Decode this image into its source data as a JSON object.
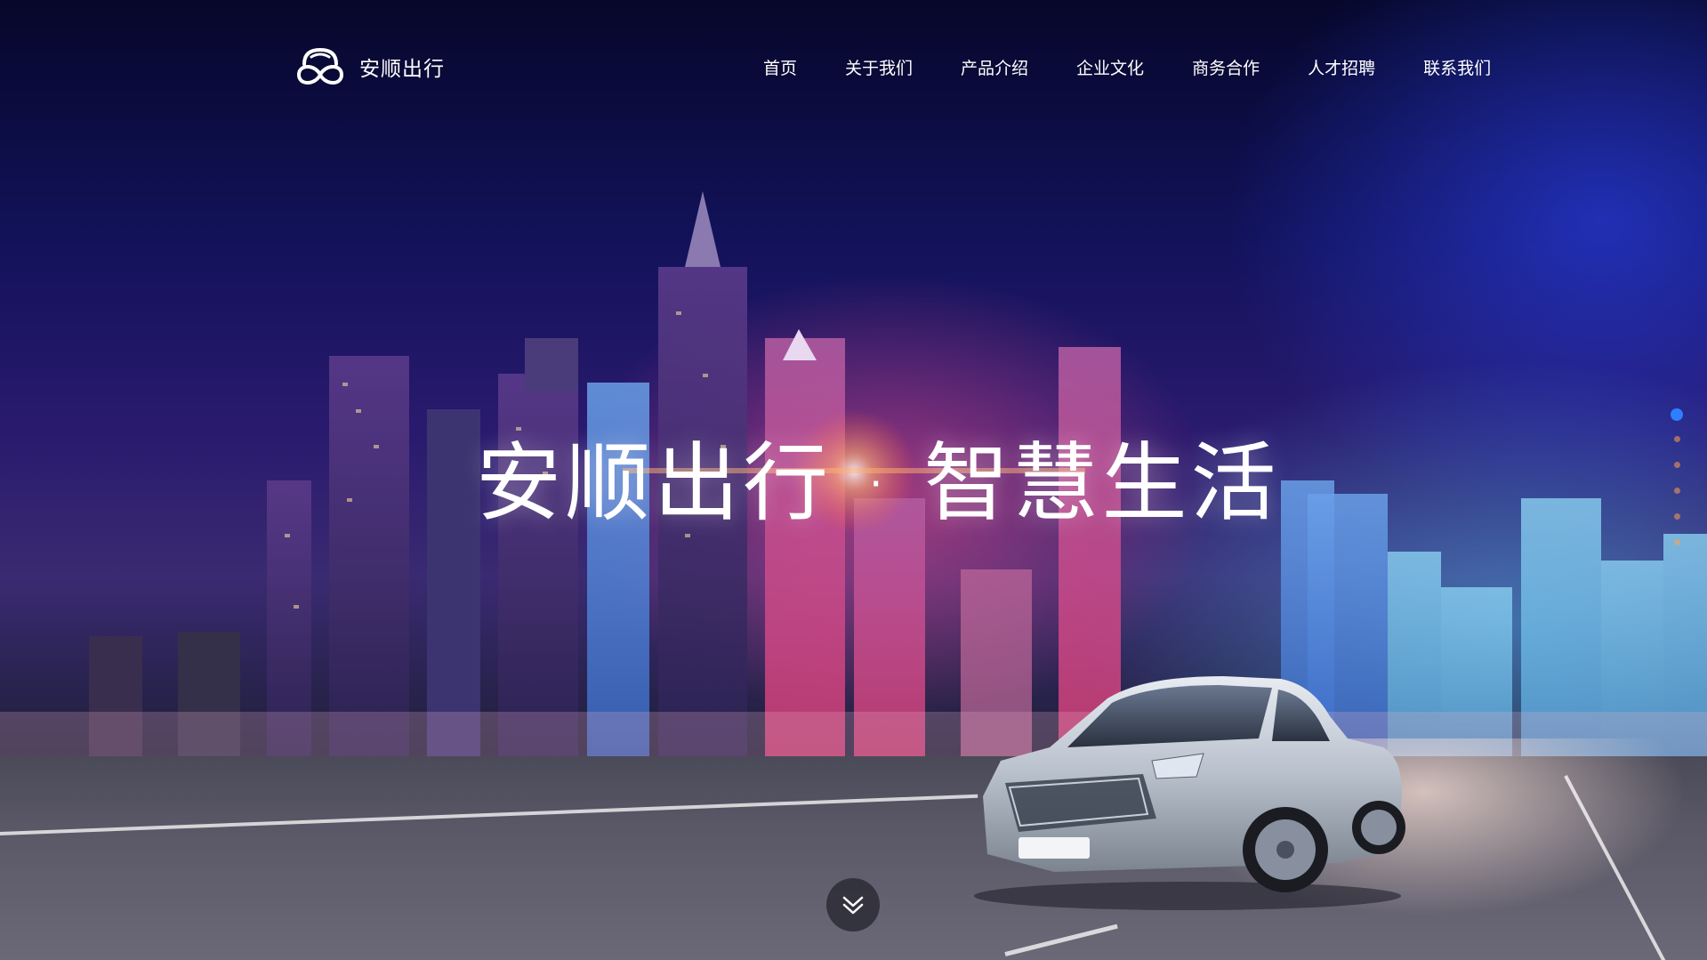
{
  "brand": {
    "name": "安顺出行",
    "logo_icon": "cloud-infinity-logo-icon"
  },
  "nav": {
    "items": [
      {
        "label": "首页"
      },
      {
        "label": "关于我们"
      },
      {
        "label": "产品介绍"
      },
      {
        "label": "企业文化"
      },
      {
        "label": "商务合作"
      },
      {
        "label": "人才招聘"
      },
      {
        "label": "联系我们"
      }
    ]
  },
  "hero": {
    "headline": "安顺出行 · 智慧生活",
    "scroll_icon": "double-chevron-down-icon"
  },
  "pagination": {
    "count": 6,
    "active_index": 0,
    "active_color": "#2d7fff"
  },
  "colors": {
    "sky_top": "#06072a",
    "sky_mid": "#2a1a6e",
    "accent_pink": "#ff508c",
    "accent_cyan": "#50c8ff"
  }
}
